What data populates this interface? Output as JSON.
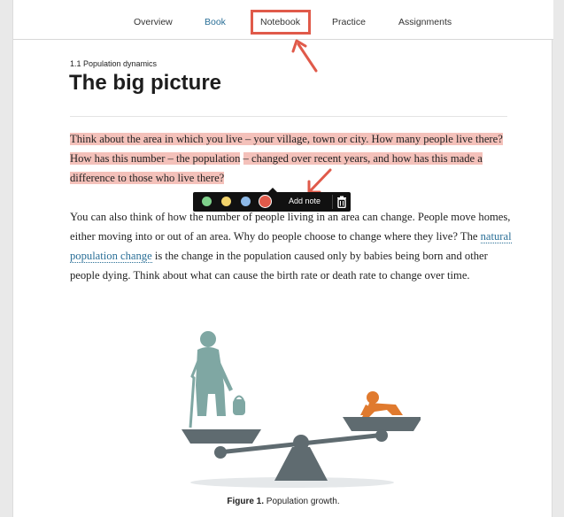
{
  "nav": {
    "tabs": [
      {
        "label": "Overview"
      },
      {
        "label": "Book"
      },
      {
        "label": "Notebook"
      },
      {
        "label": "Practice"
      },
      {
        "label": "Assignments"
      }
    ],
    "active_tab": "Book",
    "highlighted_tab": "Notebook"
  },
  "breadcrumb": "1.1 Population dynamics",
  "title": "The big picture",
  "para1": {
    "segments": [
      "Think about the area in which you live – your village, town or city. How many people live there? How has this number – the population",
      " ",
      "– changed over recent years, and how has this made a difference to those who live there?"
    ]
  },
  "para2": {
    "before_link": "You can also think of how the number of people living in an area can change. People move homes, either moving into or out of an area. Why do people choose to change where they live? The ",
    "link": "natural population change",
    "after_link": " is the change in the population caused only by babies being born and other people dying. Think about what can cause the birth rate or death rate to change over time."
  },
  "toolbar": {
    "swatches": [
      "green",
      "yellow",
      "blue",
      "red"
    ],
    "colors": {
      "green": "#7fd18c",
      "yellow": "#f2d36b",
      "blue": "#8db9e8",
      "red": "#e05a4a"
    },
    "add_note_label": "Add note",
    "delete_icon": "trash-icon"
  },
  "figure": {
    "caption_label": "Figure 1.",
    "caption_text": " Population growth."
  },
  "colors": {
    "annotation": "#e05a4a",
    "highlight": "#f4c1ba",
    "link": "#2a6f97"
  }
}
